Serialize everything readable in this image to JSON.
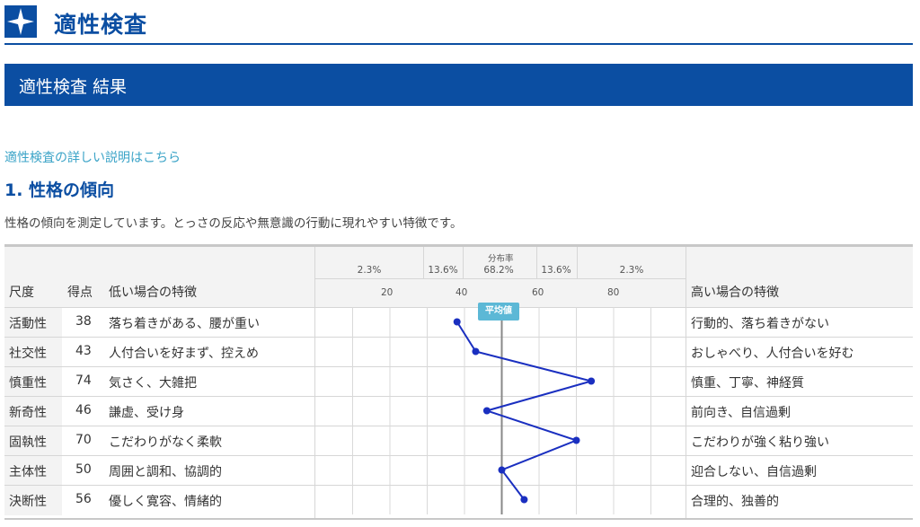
{
  "header": {
    "app_title": "適性検査",
    "logo_icon": "star-logo-icon"
  },
  "band": {
    "title": "適性検査 結果"
  },
  "link": {
    "label": "適性検査の詳しい説明はこちら"
  },
  "section": {
    "title": "1. 性格の傾向",
    "description": "性格の傾向を測定しています。とっさの反応や無意識の行動に現れやすい特徴です。"
  },
  "table": {
    "col_scale": "尺度",
    "col_score": "得点",
    "col_low": "低い場合の特徴",
    "col_high": "高い場合の特徴",
    "distribution_label": "分布率",
    "distribution": [
      "2.3%",
      "13.6%",
      "68.2%",
      "13.6%",
      "2.3%"
    ],
    "ticks": [
      "20",
      "40",
      "60",
      "80"
    ],
    "average_badge": "平均値",
    "rows": [
      {
        "scale": "活動性",
        "score": "38",
        "low": "落ち着きがある、腰が重い",
        "high": "行動的、落ち着きがない"
      },
      {
        "scale": "社交性",
        "score": "43",
        "low": "人付合いを好まず、控えめ",
        "high": "おしゃべり、人付合いを好む"
      },
      {
        "scale": "慎重性",
        "score": "74",
        "low": "気さく、大雑把",
        "high": "慎重、丁寧、神経質"
      },
      {
        "scale": "新奇性",
        "score": "46",
        "low": "謙虚、受け身",
        "high": "前向き、自信過剰"
      },
      {
        "scale": "固執性",
        "score": "70",
        "low": "こだわりがなく柔軟",
        "high": "こだわりが強く粘り強い"
      },
      {
        "scale": "主体性",
        "score": "50",
        "low": "周囲と調和、協調的",
        "high": "迎合しない、自信過剰"
      },
      {
        "scale": "決断性",
        "score": "56",
        "low": "優しく寛容、情緒的",
        "high": "合理的、独善的"
      }
    ]
  },
  "chart_data": {
    "type": "line",
    "categories": [
      "活動性",
      "社交性",
      "慎重性",
      "新奇性",
      "固執性",
      "主体性",
      "決断性"
    ],
    "values": [
      38,
      43,
      74,
      46,
      70,
      50,
      56
    ],
    "x_ticks": [
      20,
      40,
      60,
      80
    ],
    "average": 50,
    "line_color": "#1a2fc0",
    "average_color": "#888888"
  }
}
